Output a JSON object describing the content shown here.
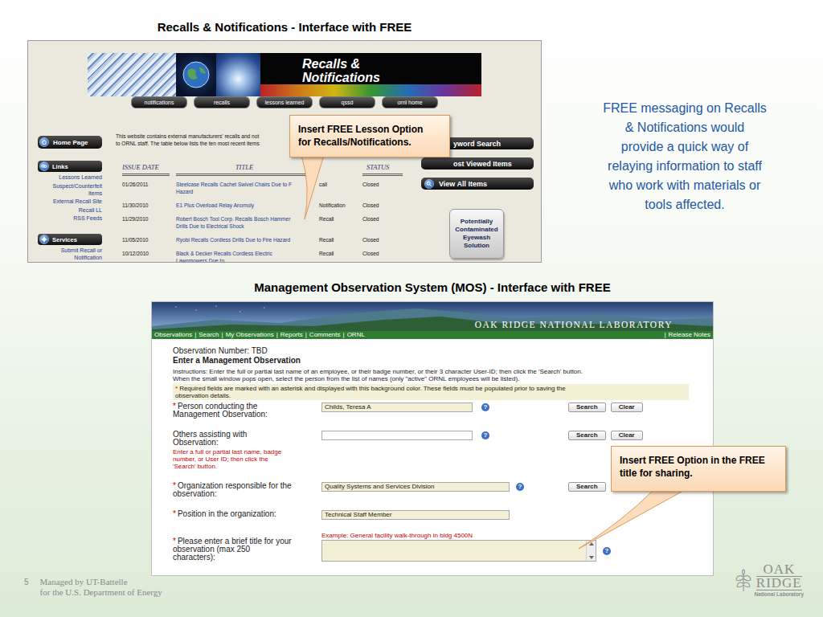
{
  "recalls": {
    "heading": "Recalls & Notifications - Interface with FREE",
    "screenshot": {
      "banner_title": "Recalls & Notifications",
      "nav": [
        "notifications",
        "recalls",
        "lessons learned",
        "qssd",
        "ornl home"
      ],
      "home": "Home Page",
      "sidebar": [
        {
          "title": "Links",
          "items": [
            {
              "lines": [
                "Lessons Learned"
              ]
            },
            {
              "lines": [
                "Suspect/Counterfeit",
                "Items"
              ]
            },
            {
              "lines": [
                "External Recall Site"
              ]
            },
            {
              "lines": [
                "Recall LL"
              ]
            },
            {
              "lines": [
                "RSS Feeds"
              ]
            }
          ]
        },
        {
          "title": "Services",
          "items": [
            {
              "lines": [
                "Submit Recall or",
                "Notification"
              ]
            }
          ]
        }
      ],
      "intro": [
        "This website contains external manufacturers' recalls and not",
        "to ORNL staff. The table below lists the ten most recent items"
      ],
      "table": {
        "columns": {
          "date": "ISSUE DATE",
          "title": "TITLE",
          "status": "STATUS"
        },
        "rows": [
          {
            "date": "01/26/2011",
            "title": [
              "Steelcase Recalls Cachet Swivel Chairs Due to F",
              "Hazard"
            ],
            "type": "call",
            "status": "Closed"
          },
          {
            "date": "11/30/2010",
            "title": [
              "E1 Plus Overload Relay Anomoly"
            ],
            "type": "Notification",
            "status": "Closed"
          },
          {
            "date": "11/29/2010",
            "title": [
              "Robert Bosch Tool Corp. Recalls Bosch Hammer",
              "Drills Due to Electrical Shock"
            ],
            "type": "Recall",
            "status": "Closed"
          },
          {
            "date": "11/05/2010",
            "title": [
              "Ryobi Recalls Cordless Drills Due to Fire Hazard"
            ],
            "type": "Recall",
            "status": "Closed"
          },
          {
            "date": "10/12/2010",
            "title": [
              "Black & Decker Recalls Cordless Electric",
              "Lawnmowers Due to"
            ],
            "type": "Recall",
            "status": "Closed"
          }
        ]
      },
      "actions": [
        {
          "label": "yword Search",
          "kind": "partial"
        },
        {
          "label": "ost Viewed Items",
          "kind": "partial"
        },
        {
          "label": "View All Items",
          "kind": "full"
        }
      ],
      "feature_button": [
        "Potentially",
        "Contaminated",
        "Eyewash",
        "Solution"
      ],
      "callout": [
        "Insert FREE Lesson Option",
        "for Recalls/Notifications."
      ]
    },
    "note": [
      "FREE messaging on Recalls",
      "& Notifications would",
      "provide a quick way of",
      "relaying information to staff",
      "who work with materials or",
      "tools affected."
    ]
  },
  "mos": {
    "heading": "Management Observation System (MOS) - Interface with FREE",
    "screenshot": {
      "banner_title": "OAK RIDGE NATIONAL LABORATORY",
      "nav": [
        "Observations",
        "Search",
        "My Observations",
        "Reports",
        "Comments",
        "ORNL"
      ],
      "separator": "|",
      "release_notes": "Release Notes",
      "observation_number": "Observation Number: TBD",
      "form_title": "Enter a Management Observation",
      "instructions": [
        "Instructions: Enter the full or partial last name of an employee, or their badge number, or their 3 character User-ID; then click the 'Search' button.",
        "When the small window pops open, select the person from the list of names (only \"active\" ORNL employees will be listed)."
      ],
      "required_mark": "*",
      "help_glyph": "?",
      "required_note": [
        "Required fields are marked with an asterisk and displayed with this background color. These fields must be populated prior to saving the",
        "observation details."
      ],
      "fields": [
        {
          "kind": "lookup",
          "required": true,
          "label": [
            "Person conducting the",
            "Management Observation:"
          ],
          "hint": [],
          "value": "Childs, Teresa A",
          "help": true,
          "buttons": [
            "Search",
            "Clear"
          ]
        },
        {
          "kind": "lookup",
          "required": false,
          "label": [
            "Others assisting with",
            "Observation:"
          ],
          "hint": [
            "Enter a full or partial last name, badge",
            "number, or User ID; then click the",
            "'Search' button."
          ],
          "value": "",
          "help": true,
          "buttons": [
            "Search",
            "Clear"
          ]
        },
        {
          "kind": "picker",
          "required": true,
          "label": [
            "Organization responsible for the",
            "observation:"
          ],
          "hint": [],
          "value": "Quality Systems and Services Division",
          "help": true,
          "buttons": [
            "Search"
          ]
        },
        {
          "kind": "text",
          "required": true,
          "label": [
            "Position in the organization:"
          ],
          "hint": [],
          "value": "Technical Staff Member",
          "help": false,
          "buttons": []
        },
        {
          "kind": "textarea",
          "required": true,
          "label": [
            "Please enter a brief title for your",
            "observation (max 250",
            "characters):"
          ],
          "hint": [],
          "example": "Example: General facility walk-through in bldg 4500N",
          "value": "",
          "help": true,
          "buttons": []
        }
      ],
      "callout": [
        "Insert FREE Option in the FREE",
        "title for sharing."
      ]
    }
  },
  "footer": {
    "page": "5",
    "lines": [
      "Managed by UT-Battelle",
      "for the U.S. Department of Energy"
    ]
  },
  "logo": {
    "lines": [
      "OAK",
      "RIDGE"
    ],
    "caption": "National Laboratory"
  }
}
